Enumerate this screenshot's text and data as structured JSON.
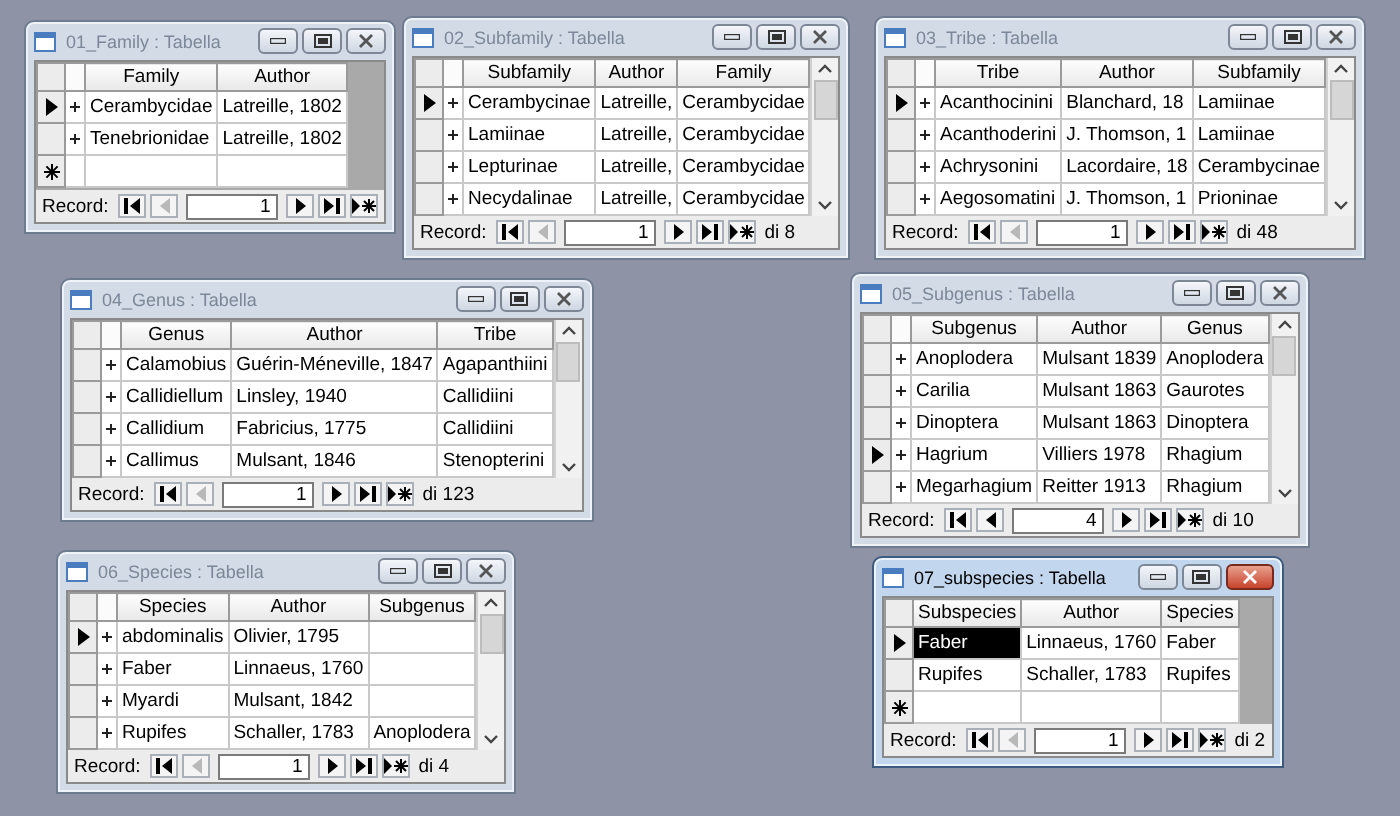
{
  "windows": [
    {
      "title": "01_Family : Tabella",
      "active": false,
      "scrollbar": false,
      "new_row": true,
      "columns": [
        "Family",
        "Author"
      ],
      "rows": [
        {
          "current": true,
          "expandable": true,
          "cells": [
            "Cerambycidae",
            "Latreille, 1802"
          ]
        },
        {
          "current": false,
          "expandable": true,
          "cells": [
            "Tenebrionidae",
            "Latreille, 1802"
          ]
        }
      ],
      "nav": {
        "label": "Record:",
        "record": "1",
        "prev_disabled": true
      }
    },
    {
      "title": "02_Subfamily : Tabella",
      "active": false,
      "scrollbar": true,
      "new_row": false,
      "columns": [
        "Subfamily",
        "Author",
        "Family"
      ],
      "rows": [
        {
          "current": true,
          "expandable": true,
          "cells": [
            "Cerambycinae",
            "Latreille,",
            "Cerambycidae"
          ]
        },
        {
          "current": false,
          "expandable": true,
          "cells": [
            "Lamiinae",
            "Latreille,",
            "Cerambycidae"
          ]
        },
        {
          "current": false,
          "expandable": true,
          "cells": [
            "Lepturinae",
            "Latreille,",
            "Cerambycidae"
          ]
        },
        {
          "current": false,
          "expandable": true,
          "cells": [
            "Necydalinae",
            "Latreille,",
            "Cerambycidae"
          ]
        }
      ],
      "nav": {
        "label": "Record:",
        "record": "1",
        "prev_disabled": true,
        "total": "di 8"
      }
    },
    {
      "title": "03_Tribe : Tabella",
      "active": false,
      "scrollbar": true,
      "new_row": false,
      "columns": [
        "Tribe",
        "Author",
        "Subfamily"
      ],
      "rows": [
        {
          "current": true,
          "expandable": true,
          "cells": [
            "Acanthocinini",
            "Blanchard, 18",
            "Lamiinae"
          ]
        },
        {
          "current": false,
          "expandable": true,
          "cells": [
            "Acanthoderini",
            "J. Thomson, 1",
            "Lamiinae"
          ]
        },
        {
          "current": false,
          "expandable": true,
          "cells": [
            "Achrysonini",
            "Lacordaire, 18",
            "Cerambycinae"
          ]
        },
        {
          "current": false,
          "expandable": true,
          "cells": [
            "Aegosomatini",
            "J. Thomson, 1",
            "Prioninae"
          ]
        }
      ],
      "nav": {
        "label": "Record:",
        "record": "1",
        "prev_disabled": true,
        "total": "di 48"
      }
    },
    {
      "title": "04_Genus : Tabella",
      "active": false,
      "scrollbar": true,
      "new_row": false,
      "columns": [
        "Genus",
        "Author",
        "Tribe"
      ],
      "rows": [
        {
          "current": false,
          "expandable": true,
          "cells": [
            "Calamobius",
            "Guérin-Méneville, 1847",
            "Agapanthiini"
          ]
        },
        {
          "current": false,
          "expandable": true,
          "cells": [
            "Callidiellum",
            "Linsley, 1940",
            "Callidiini"
          ]
        },
        {
          "current": false,
          "expandable": true,
          "cells": [
            "Callidium",
            "Fabricius, 1775",
            "Callidiini"
          ]
        },
        {
          "current": false,
          "expandable": true,
          "cells": [
            "Callimus",
            "Mulsant, 1846",
            "Stenopterini"
          ]
        }
      ],
      "nav": {
        "label": "Record:",
        "record": "1",
        "prev_disabled": true,
        "total": "di 123"
      }
    },
    {
      "title": "05_Subgenus : Tabella",
      "active": false,
      "scrollbar": true,
      "new_row": false,
      "columns": [
        "Subgenus",
        "Author",
        "Genus"
      ],
      "rows": [
        {
          "current": false,
          "expandable": true,
          "cells": [
            "Anoplodera",
            "Mulsant 1839",
            "Anoplodera"
          ]
        },
        {
          "current": false,
          "expandable": true,
          "cells": [
            "Carilia",
            "Mulsant 1863",
            "Gaurotes"
          ]
        },
        {
          "current": false,
          "expandable": true,
          "cells": [
            "Dinoptera",
            "Mulsant 1863",
            "Dinoptera"
          ]
        },
        {
          "current": true,
          "expandable": true,
          "cells": [
            "Hagrium",
            "Villiers 1978",
            "Rhagium"
          ]
        },
        {
          "current": false,
          "expandable": true,
          "cells": [
            "Megarhagium",
            "Reitter 1913",
            "Rhagium"
          ]
        }
      ],
      "nav": {
        "label": "Record:",
        "record": "4",
        "prev_disabled": false,
        "total": "di 10"
      }
    },
    {
      "title": "06_Species : Tabella",
      "active": false,
      "scrollbar": true,
      "new_row": false,
      "columns": [
        "Species",
        "Author",
        "Subgenus"
      ],
      "rows": [
        {
          "current": true,
          "expandable": true,
          "cells": [
            "abdominalis",
            "Olivier, 1795",
            ""
          ]
        },
        {
          "current": false,
          "expandable": true,
          "cells": [
            "Faber",
            "Linnaeus, 1760",
            ""
          ]
        },
        {
          "current": false,
          "expandable": true,
          "cells": [
            "Myardi",
            "Mulsant, 1842",
            ""
          ]
        },
        {
          "current": false,
          "expandable": true,
          "cells": [
            "Rupifes",
            "Schaller, 1783",
            "Anoplodera"
          ]
        }
      ],
      "nav": {
        "label": "Record:",
        "record": "1",
        "prev_disabled": true,
        "total": "di 4"
      }
    },
    {
      "title": "07_subspecies : Tabella",
      "active": true,
      "scrollbar": false,
      "new_row": true,
      "columns": [
        "Subspecies",
        "Author",
        "Species"
      ],
      "rows": [
        {
          "current": true,
          "expandable": false,
          "cells": [
            {
              "text": "Faber",
              "selected": true
            },
            "Linnaeus, 1760",
            "Faber"
          ]
        },
        {
          "current": false,
          "expandable": false,
          "cells": [
            "Rupifes",
            "Schaller, 1783",
            "Rupifes"
          ]
        }
      ],
      "nav": {
        "label": "Record:",
        "record": "1",
        "prev_disabled": true,
        "total": "di 2"
      }
    }
  ]
}
